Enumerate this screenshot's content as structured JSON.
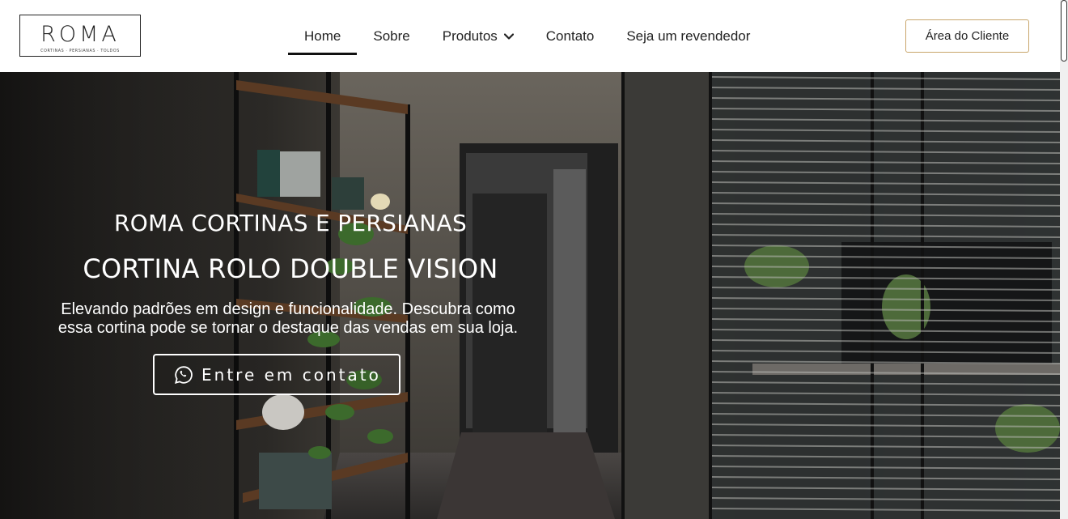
{
  "header": {
    "logo": {
      "word": "ROMA",
      "tagline": "Cortinas · Persianas · Toldos"
    },
    "nav": [
      {
        "label": "Home",
        "active": true
      },
      {
        "label": "Sobre"
      },
      {
        "label": "Produtos",
        "icon": "chevron-down-icon"
      },
      {
        "label": "Contato"
      },
      {
        "label": "Seja um revendedor"
      }
    ],
    "client_button": "Área do Cliente"
  },
  "hero": {
    "title": "ROMA CORTINAS E PERSIANAS",
    "subtitle": "CORTINA ROLO DOUBLE VISION",
    "description_line1": "Elevando padrões em design e funcionalidade. Descubra como",
    "description_line2": "essa cortina pode se tornar o destaque das vendas em sua loja.",
    "cta": {
      "label": "Entre em contato",
      "icon": "whatsapp-icon"
    }
  },
  "colors": {
    "accent_border": "#c9a66b",
    "nav_active": "#111111",
    "hero_text": "#ffffff"
  }
}
